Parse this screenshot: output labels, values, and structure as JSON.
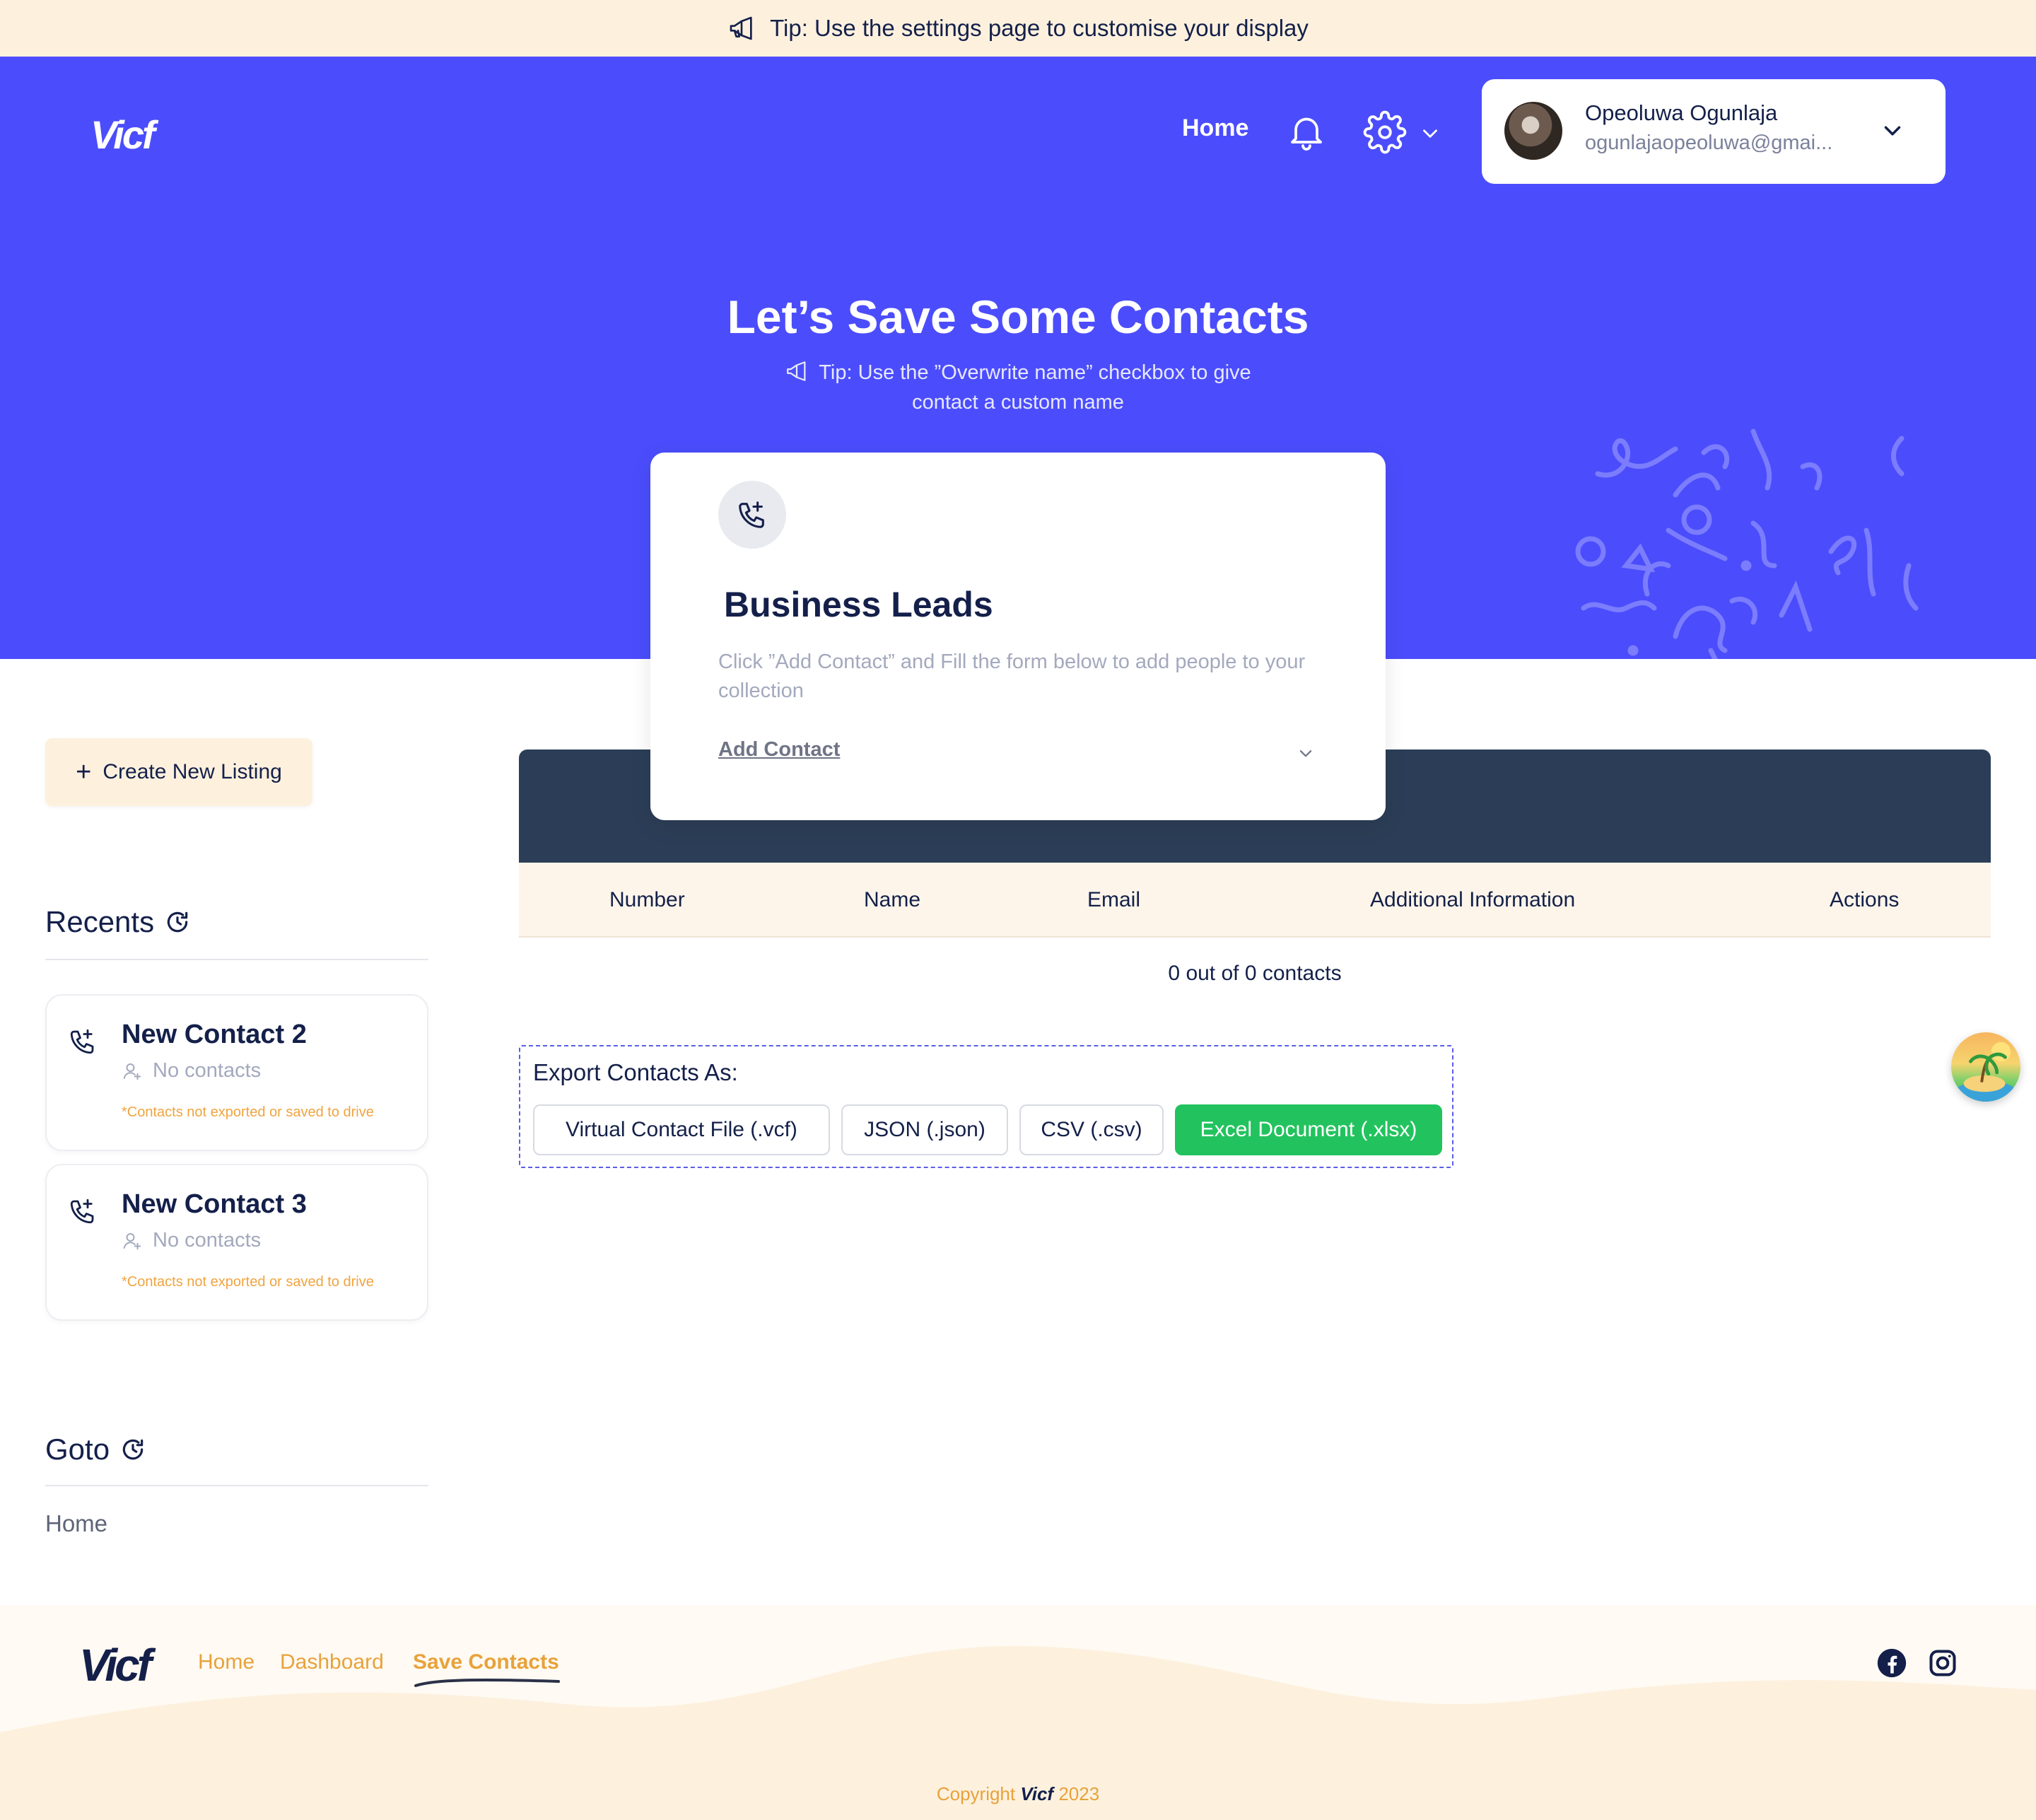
{
  "tipbar": {
    "icon": "megaphone-icon",
    "text": "Tip: Use the settings page to customise your display"
  },
  "header": {
    "logo": "Vicf",
    "nav_home": "Home",
    "notification_icon": "bell-icon",
    "settings_icon": "gear-icon",
    "user": {
      "name": "Opeoluwa Ogunlaja",
      "email": "ogunlajaopeoluwa@gmai..."
    }
  },
  "hero": {
    "title": "Let’s Save Some Contacts",
    "tip": "Tip: Use the ”Overwrite name” checkbox to give contact a custom name"
  },
  "listing_card": {
    "icon": "phone-plus-icon",
    "title": "Business Leads",
    "description": "Click ”Add Contact” and Fill the form below to add people to your collection",
    "add_contact": "Add Contact"
  },
  "sidebar": {
    "create_button": "Create New Listing",
    "recents_title": "Recents",
    "recents": [
      {
        "name": "New Contact 2",
        "count": "No contacts",
        "note": "*Contacts not exported or saved to drive"
      },
      {
        "name": "New Contact 3",
        "count": "No contacts",
        "note": "*Contacts not exported or saved to drive"
      }
    ],
    "goto_title": "Goto",
    "goto_links": [
      "Home"
    ]
  },
  "table": {
    "columns": [
      "Number",
      "Name",
      "Email",
      "Additional Information",
      "Actions"
    ],
    "empty_text": "0 out of 0 contacts"
  },
  "export": {
    "label": "Export Contacts As:",
    "buttons": [
      "Virtual Contact File (.vcf)",
      "JSON (.json)",
      "CSV (.csv)",
      "Excel Document (.xlsx)"
    ],
    "primary_color": "#22c35e"
  },
  "footer": {
    "logo": "Vicf",
    "links": [
      "Home",
      "Dashboard",
      "Save Contacts"
    ],
    "active_link": "Save Contacts",
    "social_icons": [
      "facebook-icon",
      "instagram-icon"
    ],
    "copyright_prefix": "Copyright",
    "copyright_brand": "Vicf",
    "copyright_year": "2023"
  },
  "colors": {
    "brand": "#4b4dfc",
    "tip_bg": "#fdf1de",
    "table_head": "#2c3e57",
    "accent_orange": "#e8a23a",
    "text_dark": "#14204a"
  }
}
